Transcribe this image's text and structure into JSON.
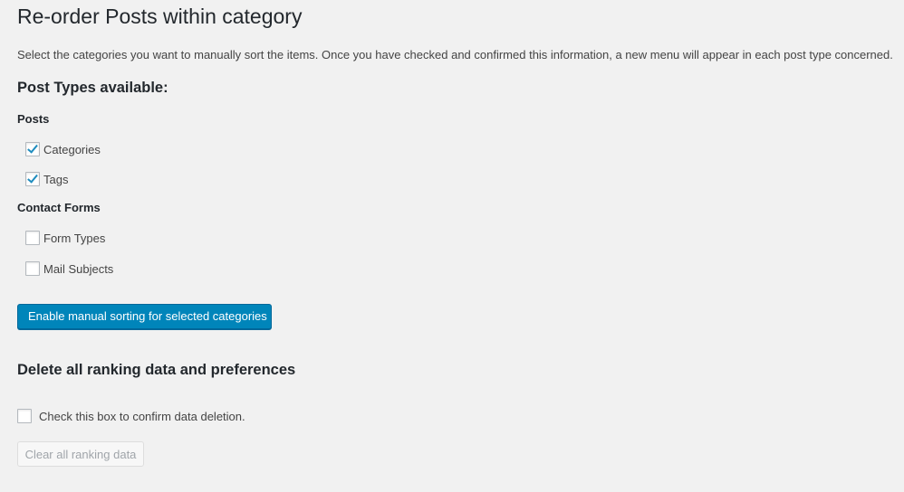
{
  "page": {
    "title": "Re-order Posts within category",
    "intro": "Select the categories you want to manually sort the items. Once you have checked and confirmed this information, a new menu will appear in each post type concerned."
  },
  "post_types": {
    "heading": "Post Types available:",
    "groups": [
      {
        "label": "Posts",
        "items": [
          {
            "label": "Categories",
            "checked": true
          },
          {
            "label": "Tags",
            "checked": true
          }
        ]
      },
      {
        "label": "Contact Forms",
        "items": [
          {
            "label": "Form Types",
            "checked": false
          },
          {
            "label": "Mail Subjects",
            "checked": false
          }
        ]
      }
    ],
    "submit_label": "Enable manual sorting for selected categories"
  },
  "delete_section": {
    "heading": "Delete all ranking data and preferences",
    "confirm_label": "Check this box to confirm data deletion.",
    "confirm_checked": false,
    "clear_label": "Clear all ranking data"
  },
  "colors": {
    "primary": "#0085ba",
    "check": "#1e8cbe",
    "background": "#f1f1f1"
  }
}
